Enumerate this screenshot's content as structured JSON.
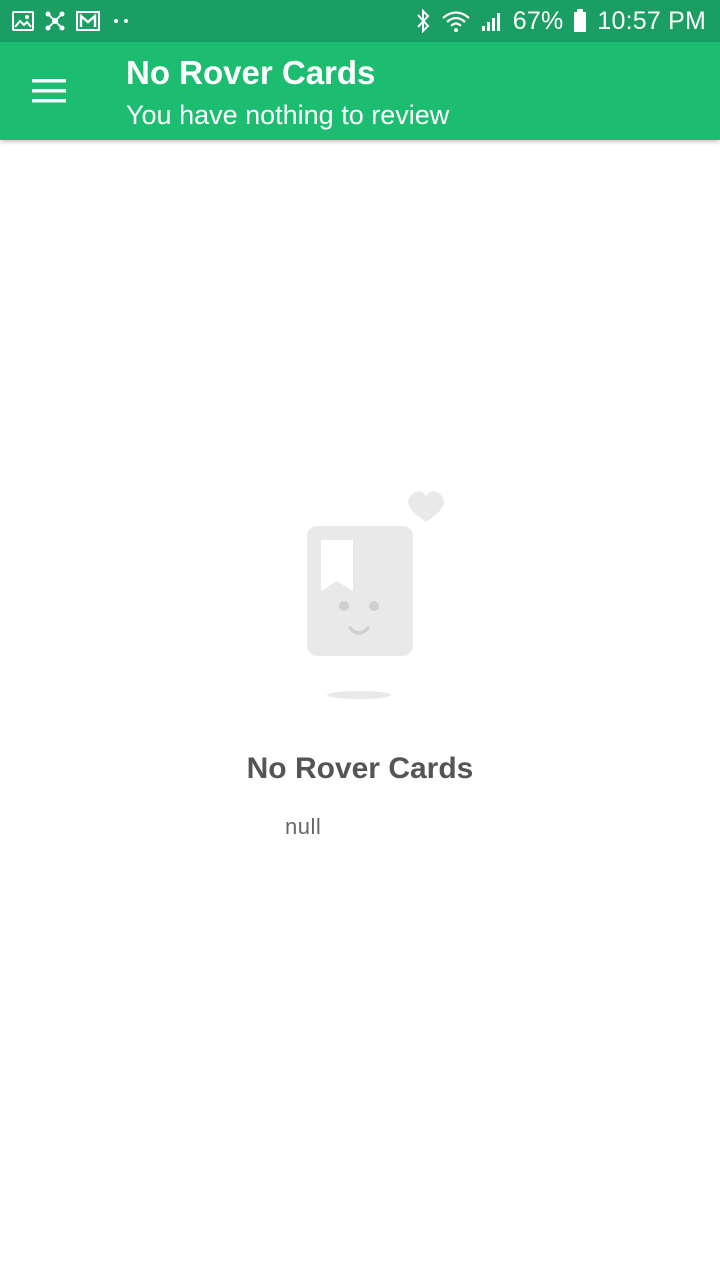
{
  "status_bar": {
    "battery": "67%",
    "time": "10:57 PM",
    "left_icons": [
      "gallery-icon",
      "network-icon",
      "gmail-icon",
      "more-dots-icon"
    ],
    "right_icons": [
      "bluetooth-icon",
      "wifi-icon",
      "signal-icon",
      "battery-icon"
    ]
  },
  "app_bar": {
    "title": "No Rover Cards",
    "subtitle": "You have nothing to review",
    "menu_icon": "hamburger-menu-icon"
  },
  "empty_state": {
    "title": "No Rover Cards",
    "message": "null",
    "illustration": "empty-card-illustration"
  },
  "colors": {
    "status_bar": "#1a9e63",
    "app_bar": "#1cbd71",
    "illustration": "#e9e9e9",
    "title_text": "#555555"
  }
}
